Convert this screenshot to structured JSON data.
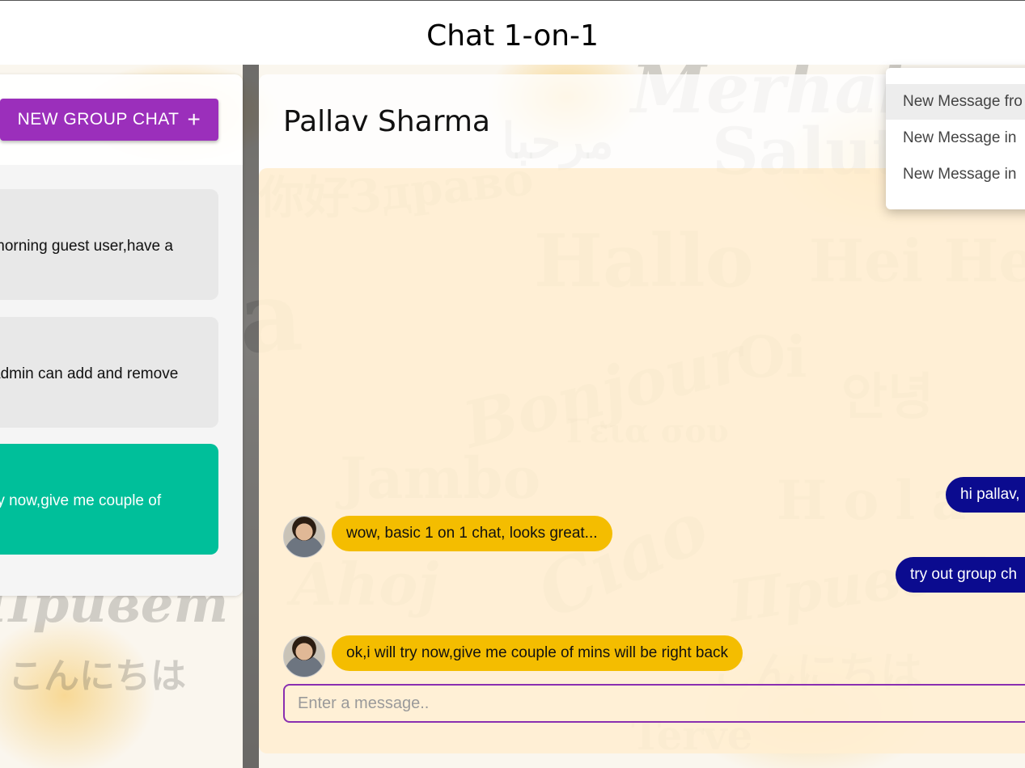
{
  "app": {
    "title": "Chat 1-on-1"
  },
  "background_words": [
    "Aloha",
    "Hallo",
    "Bonjour",
    "Jambo",
    "Ciao",
    "Ahoj",
    "Salut",
    "Hei Hei",
    "Oi",
    "Привет",
    "Здраво",
    "مرحبا",
    "안녕",
    "こんにちは",
    "你好",
    "Γεια σου",
    "Merhaba",
    "Hola",
    "Terve"
  ],
  "sidebar": {
    "new_group_label": "NEW GROUP CHAT",
    "new_group_icon": "plus-icon",
    "chats": [
      {
        "preview": "morning guest user,have a"
      },
      {
        "preview": "admin can add and remove"
      },
      {
        "preview": "ry now,give me couple of",
        "active": true
      }
    ]
  },
  "chat": {
    "title": "Pallav Sharma",
    "messages": [
      {
        "direction": "out",
        "text": "hi pallav,"
      },
      {
        "direction": "in",
        "text": "wow, basic 1 on 1 chat, looks great..."
      },
      {
        "direction": "out",
        "text": "try out group ch"
      },
      {
        "direction": "in",
        "text": "ok,i will try now,give me couple of mins will be right back"
      }
    ],
    "input_placeholder": "Enter a message.."
  },
  "notifications": [
    "New Message fro",
    "New Message in",
    "New Message in"
  ],
  "colors": {
    "accent_purple": "#9b2fbb",
    "active_chat": "#00bf9a",
    "incoming_bubble": "#f4bd00",
    "outgoing_bubble": "#0b0b8f"
  }
}
